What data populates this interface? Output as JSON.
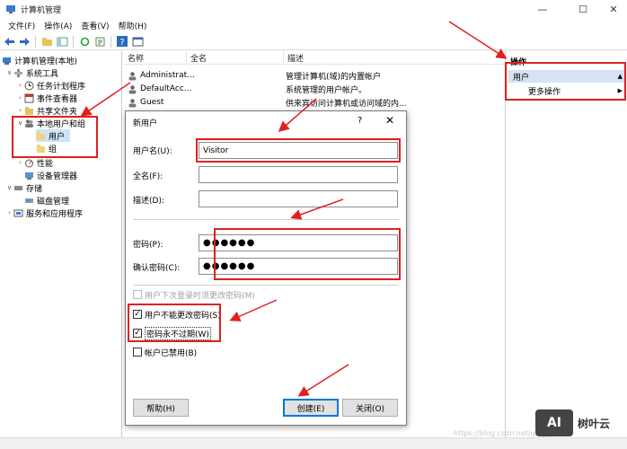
{
  "window": {
    "title": "计算机管理",
    "controls": {
      "minimize": "—",
      "maximize": "☐",
      "close": "✕"
    }
  },
  "menu": [
    "文件(F)",
    "操作(A)",
    "查看(V)",
    "帮助(H)"
  ],
  "tree": [
    {
      "label": "计算机管理(本地)",
      "expander": "",
      "icon": "computer-management-icon"
    },
    {
      "label": "系统工具",
      "expander": "∨",
      "icon": "tools-icon"
    },
    {
      "label": "任务计划程序",
      "expander": "›",
      "icon": "clock-icon"
    },
    {
      "label": "事件查看器",
      "expander": "›",
      "icon": "event-viewer-icon"
    },
    {
      "label": "共享文件夹",
      "expander": "›",
      "icon": "shared-folder-icon"
    },
    {
      "label": "本地用户和组",
      "expander": "∨",
      "icon": "users-group-icon"
    },
    {
      "label": "用户",
      "expander": "",
      "icon": "folder-icon"
    },
    {
      "label": "组",
      "expander": "",
      "icon": "folder-icon"
    },
    {
      "label": "性能",
      "expander": "›",
      "icon": "performance-icon"
    },
    {
      "label": "设备管理器",
      "expander": "",
      "icon": "device-manager-icon"
    },
    {
      "label": "存储",
      "expander": "∨",
      "icon": "storage-icon"
    },
    {
      "label": "磁盘管理",
      "expander": "",
      "icon": "disk-icon"
    },
    {
      "label": "服务和应用程序",
      "expander": "›",
      "icon": "services-icon"
    }
  ],
  "list": {
    "columns": [
      "名称",
      "全名",
      "描述"
    ],
    "rows": [
      {
        "name": "Administrat...",
        "full_name": "",
        "description": "管理计算机(域)的内置帐户"
      },
      {
        "name": "DefaultAcc...",
        "full_name": "",
        "description": "系统管理的用户帐户。"
      },
      {
        "name": "Guest",
        "full_name": "",
        "description": "供来宾访问计算机或访问域的内..."
      }
    ]
  },
  "actions": {
    "header": "操作",
    "section": "用户",
    "more": "更多操作"
  },
  "dialog": {
    "title": "新用户",
    "help": "?",
    "close": "✕",
    "username_label": "用户名(U):",
    "username_value": "Visitor",
    "fullname_label": "全名(F):",
    "fullname_value": "",
    "desc_label": "描述(D):",
    "desc_value": "",
    "password_label": "密码(P):",
    "password_value": "●●●●●●",
    "confirm_label": "确认密码(C):",
    "confirm_value": "●●●●●●",
    "checkboxes": [
      {
        "label": "用户下次登录时须更改密码(M)",
        "checked": false,
        "disabled": true
      },
      {
        "label": "用户不能更改密码(S)",
        "checked": true,
        "disabled": false
      },
      {
        "label": "密码永不过期(W)",
        "checked": true,
        "disabled": false
      },
      {
        "label": "帐户已禁用(B)",
        "checked": false,
        "disabled": false
      }
    ],
    "help_button": "帮助(H)",
    "create_button": "创建(E)",
    "close_button": "关闭(O)"
  },
  "watermark": {
    "logo": "AI",
    "text": "树叶云",
    "url": "https://blog.csdn.net/qingyun"
  },
  "colors": {
    "highlight": "#e02020",
    "selection": "#cce4f7",
    "action_header": "#d6e3f3"
  }
}
